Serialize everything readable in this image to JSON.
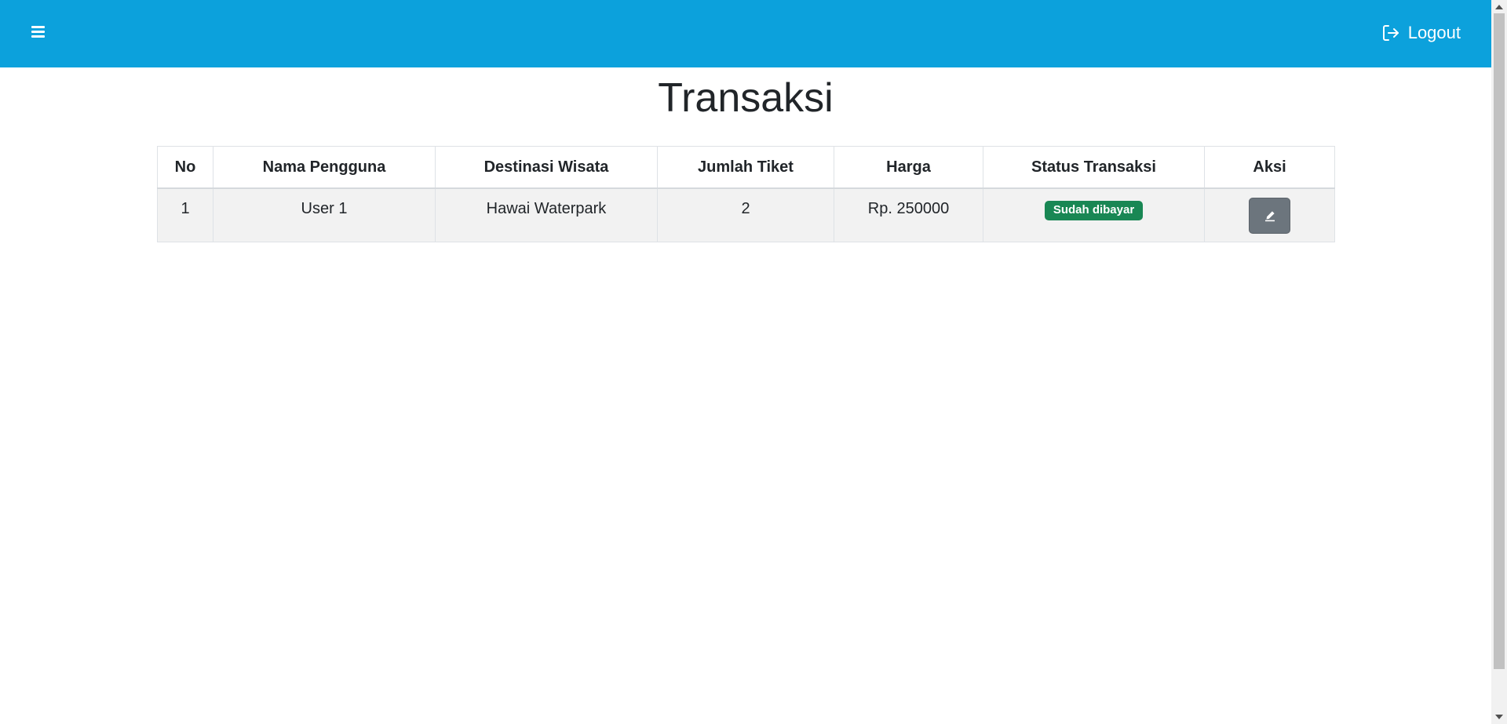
{
  "navbar": {
    "menu_icon": "hamburger-icon",
    "logout_icon": "logout-icon",
    "logout_label": "Logout"
  },
  "page": {
    "title": "Transaksi"
  },
  "table": {
    "headers": [
      "No",
      "Nama Pengguna",
      "Destinasi Wisata",
      "Jumlah Tiket",
      "Harga",
      "Status Transaksi",
      "Aksi"
    ],
    "rows": [
      {
        "no": "1",
        "nama_pengguna": "User 1",
        "destinasi_wisata": "Hawai Waterpark",
        "jumlah_tiket": "2",
        "harga": "Rp. 250000",
        "status": "Sudah dibayar",
        "action_icon": "pencil-icon"
      }
    ]
  },
  "colors": {
    "navbar": "#0ca1dc",
    "status_badge": "#198754",
    "edit_button": "#6c757d"
  }
}
